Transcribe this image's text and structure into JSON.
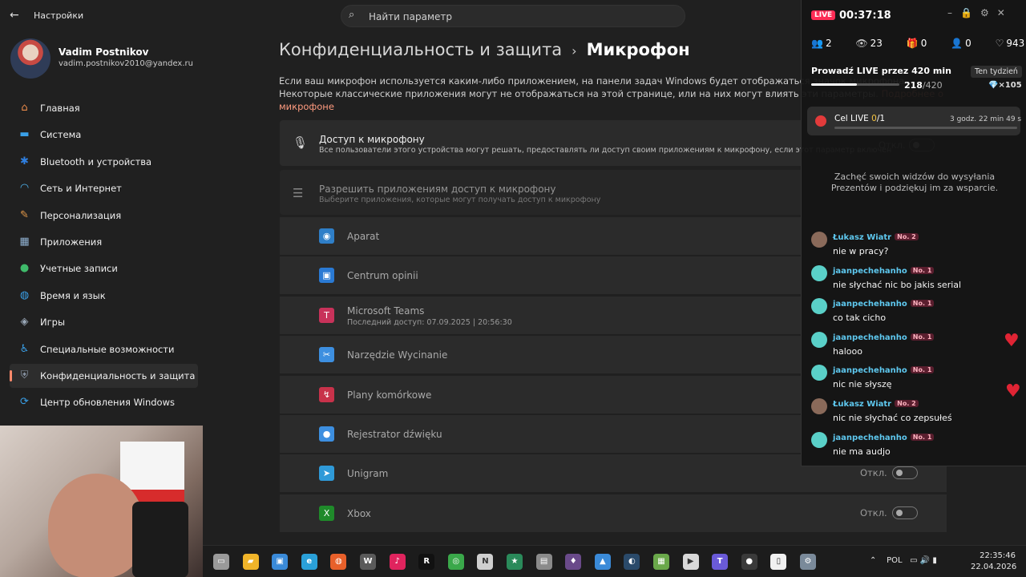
{
  "header": {
    "back_glyph": "←",
    "title": "Настройки",
    "search_placeholder": "Найти параметр"
  },
  "profile": {
    "name": "Vadim Postnikov",
    "email": "vadim.postnikov2010@yandex.ru"
  },
  "sidebar": {
    "items": [
      {
        "label": "Главная",
        "icon": "home-icon",
        "color": "#e88a4a"
      },
      {
        "label": "Система",
        "icon": "system-icon",
        "color": "#3aa0e8"
      },
      {
        "label": "Bluetooth и устройства",
        "icon": "bluetooth-icon",
        "color": "#2f7fe0"
      },
      {
        "label": "Сеть и Интернет",
        "icon": "wifi-icon",
        "color": "#4fb4f0"
      },
      {
        "label": "Персонализация",
        "icon": "brush-icon",
        "color": "#e59a4a"
      },
      {
        "label": "Приложения",
        "icon": "apps-icon",
        "color": "#8fb0d0"
      },
      {
        "label": "Учетные записи",
        "icon": "account-icon",
        "color": "#3fba6a"
      },
      {
        "label": "Время и язык",
        "icon": "globe-icon",
        "color": "#3aa0e8"
      },
      {
        "label": "Игры",
        "icon": "gamepad-icon",
        "color": "#9aa8b8"
      },
      {
        "label": "Специальные возможности",
        "icon": "accessibility-icon",
        "color": "#3aa0e8"
      },
      {
        "label": "Конфиденциальность и защита",
        "icon": "shield-icon",
        "color": "#8a96a6",
        "active": true
      },
      {
        "label": "Центр обновления Windows",
        "icon": "update-icon",
        "color": "#3aa0e8"
      }
    ]
  },
  "breadcrumb": {
    "parent": "Конфиденциальность и защита",
    "separator": "›",
    "current": "Микрофон"
  },
  "description": {
    "text": "Если ваш микрофон используется каким-либо приложением, на панели задач Windows будет отображаться значок микрофона. Некоторые классические приложения могут не отображаться на этой странице, или на них могут влиять эти параметры.",
    "link": "Подробнее о микрофоне"
  },
  "access_card": {
    "title": "Доступ к микрофону",
    "subtitle": "Все пользователи этого устройства могут решать, предоставлять ли доступ своим приложениям к микрофону, если этот параметр включен",
    "state": "Откл."
  },
  "apps_card": {
    "title": "Разрешить приложениям доступ к микрофону",
    "subtitle": "Выберите приложения, которые могут получать доступ к микрофону"
  },
  "apps": [
    {
      "name": "Aparat",
      "sub": "",
      "state": "",
      "icon": "camera-icon",
      "color": "#2f7fc8"
    },
    {
      "name": "Centrum opinii",
      "sub": "",
      "state": "",
      "icon": "feedback-icon",
      "color": "#2a7ad4"
    },
    {
      "name": "Microsoft Teams",
      "sub": "Последний доступ: 07.09.2025  |  20:56:30",
      "state": "",
      "icon": "teams-icon",
      "color": "#c8325a"
    },
    {
      "name": "Narzędzie Wycinanie",
      "sub": "",
      "state": "",
      "icon": "snipping-icon",
      "color": "#3d8fe0"
    },
    {
      "name": "Plany komórkowe",
      "sub": "",
      "state": "",
      "icon": "cellular-icon",
      "color": "#c8324a"
    },
    {
      "name": "Rejestrator dźwięku",
      "sub": "",
      "state": "",
      "icon": "recorder-icon",
      "color": "#3d8fe0"
    },
    {
      "name": "Unigram",
      "sub": "",
      "state": "Откл.",
      "icon": "telegram-icon",
      "color": "#2f9ad8"
    },
    {
      "name": "Xbox",
      "sub": "",
      "state": "Откл.",
      "icon": "xbox-icon",
      "color": "#1f8a2a"
    }
  ],
  "live": {
    "badge": "LIVE",
    "time": "00:37:18",
    "stats": {
      "guests": "2",
      "viewers": "23",
      "gifts": "0",
      "follows": "0",
      "likes": "943"
    },
    "goal": {
      "title": "Prowadź LIVE przez 420 min",
      "tag": "Ten tydzień",
      "current": "218",
      "total": "/420",
      "progress": 0.519,
      "reward": "×105"
    },
    "cel": {
      "label": "Cel LIVE ",
      "count": "0",
      "total": "/1",
      "time": "3 godz. 22 min 49 s"
    },
    "gift_message": "Zachęć swoich widzów do wysyłania Prezentów i podziękuj im za wsparcie.",
    "chat": [
      {
        "user": "Łukasz Wiatr",
        "badge": "No. 2",
        "text": "nie w pracy?",
        "avatar_color": "#8a6a5a"
      },
      {
        "user": "jaanpechehanho",
        "badge": "No. 1",
        "text": "nie słychać nic bo jakis serial",
        "avatar_color": "#5ad0c8"
      },
      {
        "user": "jaanpechehanho",
        "badge": "No. 1",
        "text": "co tak cicho",
        "avatar_color": "#5ad0c8"
      },
      {
        "user": "jaanpechehanho",
        "badge": "No. 1",
        "text": "halooo",
        "avatar_color": "#5ad0c8"
      },
      {
        "user": "jaanpechehanho",
        "badge": "No. 1",
        "text": "nic nie słyszę",
        "avatar_color": "#5ad0c8"
      },
      {
        "user": "Łukasz Wiatr",
        "badge": "No. 2",
        "text": "nic nie słychać co zepsułeś",
        "avatar_color": "#8a6a5a"
      },
      {
        "user": "jaanpechehanho",
        "badge": "No. 1",
        "text": "nie ma audjo",
        "avatar_color": "#5ad0c8"
      }
    ]
  },
  "taskbar": {
    "icons": [
      {
        "name": "desktop-icon",
        "color": "#9a9a9a"
      },
      {
        "name": "explorer-icon",
        "color": "#f0b429"
      },
      {
        "name": "photos-icon",
        "color": "#3a8ad8"
      },
      {
        "name": "edge-icon",
        "color": "#2aa0d8"
      },
      {
        "name": "firefox-icon",
        "color": "#e8602a"
      },
      {
        "name": "wot-icon",
        "color": "#5a5a5a"
      },
      {
        "name": "tiktok-icon",
        "color": "#e0245e"
      },
      {
        "name": "r-icon",
        "color": "#111111"
      },
      {
        "name": "chrome-icon",
        "color": "#3aa84a"
      },
      {
        "name": "compass-icon",
        "color": "#cfcfcf"
      },
      {
        "name": "star-icon",
        "color": "#2a8a5a"
      },
      {
        "name": "box-icon",
        "color": "#8a8a8a"
      },
      {
        "name": "game-icon",
        "color": "#6a4a8a"
      },
      {
        "name": "image-icon",
        "color": "#3a8ad8"
      },
      {
        "name": "steam-icon",
        "color": "#2a4a6a"
      },
      {
        "name": "minecraft-icon",
        "color": "#6aa84a"
      },
      {
        "name": "player-icon",
        "color": "#d8d8d8"
      },
      {
        "name": "teams-icon",
        "color": "#6a5ad8"
      },
      {
        "name": "obs-icon",
        "color": "#3a3a3a"
      },
      {
        "name": "file-icon",
        "color": "#f0f0f0"
      },
      {
        "name": "settings-icon",
        "color": "#7a8a9a"
      }
    ],
    "tray_lang": "POL",
    "time": "22:35:46",
    "date": "22.04.2026"
  }
}
